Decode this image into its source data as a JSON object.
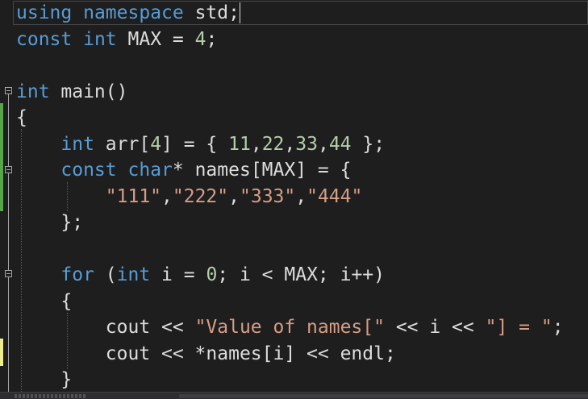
{
  "editor": {
    "lines": [
      {
        "tokens": [
          {
            "t": "using",
            "c": "kw"
          },
          {
            "t": " ",
            "c": "plain"
          },
          {
            "t": "namespace",
            "c": "kw"
          },
          {
            "t": " std;",
            "c": "plain"
          }
        ]
      },
      {
        "tokens": [
          {
            "t": "const",
            "c": "kw"
          },
          {
            "t": " ",
            "c": "plain"
          },
          {
            "t": "int",
            "c": "kw"
          },
          {
            "t": " MAX = ",
            "c": "plain"
          },
          {
            "t": "4",
            "c": "num"
          },
          {
            "t": ";",
            "c": "plain"
          }
        ]
      },
      {
        "tokens": []
      },
      {
        "tokens": [
          {
            "t": "int",
            "c": "kw"
          },
          {
            "t": " main()",
            "c": "plain"
          }
        ]
      },
      {
        "tokens": [
          {
            "t": "{",
            "c": "plain"
          }
        ]
      },
      {
        "tokens": [
          {
            "t": "    ",
            "c": "plain"
          },
          {
            "t": "int",
            "c": "kw"
          },
          {
            "t": " arr[",
            "c": "plain"
          },
          {
            "t": "4",
            "c": "num"
          },
          {
            "t": "] = { ",
            "c": "plain"
          },
          {
            "t": "11",
            "c": "num"
          },
          {
            "t": ",",
            "c": "plain"
          },
          {
            "t": "22",
            "c": "num"
          },
          {
            "t": ",",
            "c": "plain"
          },
          {
            "t": "33",
            "c": "num"
          },
          {
            "t": ",",
            "c": "plain"
          },
          {
            "t": "44",
            "c": "num"
          },
          {
            "t": " };",
            "c": "plain"
          }
        ]
      },
      {
        "tokens": [
          {
            "t": "    ",
            "c": "plain"
          },
          {
            "t": "const",
            "c": "kw"
          },
          {
            "t": " ",
            "c": "plain"
          },
          {
            "t": "char",
            "c": "kw"
          },
          {
            "t": "* names[MAX] = {",
            "c": "plain"
          }
        ]
      },
      {
        "tokens": [
          {
            "t": "        ",
            "c": "plain"
          },
          {
            "t": "\"111\"",
            "c": "str"
          },
          {
            "t": ",",
            "c": "plain"
          },
          {
            "t": "\"222\"",
            "c": "str"
          },
          {
            "t": ",",
            "c": "plain"
          },
          {
            "t": "\"333\"",
            "c": "str"
          },
          {
            "t": ",",
            "c": "plain"
          },
          {
            "t": "\"444\"",
            "c": "str"
          }
        ]
      },
      {
        "tokens": [
          {
            "t": "    };",
            "c": "plain"
          }
        ]
      },
      {
        "tokens": []
      },
      {
        "tokens": [
          {
            "t": "    ",
            "c": "plain"
          },
          {
            "t": "for",
            "c": "kw"
          },
          {
            "t": " (",
            "c": "plain"
          },
          {
            "t": "int",
            "c": "kw"
          },
          {
            "t": " i = ",
            "c": "plain"
          },
          {
            "t": "0",
            "c": "num"
          },
          {
            "t": "; i < MAX; i++)",
            "c": "plain"
          }
        ]
      },
      {
        "tokens": [
          {
            "t": "    {",
            "c": "plain"
          }
        ]
      },
      {
        "tokens": [
          {
            "t": "        cout << ",
            "c": "plain"
          },
          {
            "t": "\"Value of names[\"",
            "c": "str"
          },
          {
            "t": " << i << ",
            "c": "plain"
          },
          {
            "t": "\"] = \"",
            "c": "str"
          },
          {
            "t": ";",
            "c": "plain"
          }
        ]
      },
      {
        "tokens": [
          {
            "t": "        cout << *names[i] << endl;",
            "c": "plain"
          }
        ]
      },
      {
        "tokens": [
          {
            "t": "    }",
            "c": "plain"
          }
        ]
      }
    ]
  },
  "colors": {
    "background": "#1e1e1e",
    "keyword": "#569cd6",
    "number": "#b5cea8",
    "string": "#d69d85",
    "plain": "#dcdcdc",
    "saved_change": "#57a64a",
    "unsaved_change": "#efef91"
  }
}
